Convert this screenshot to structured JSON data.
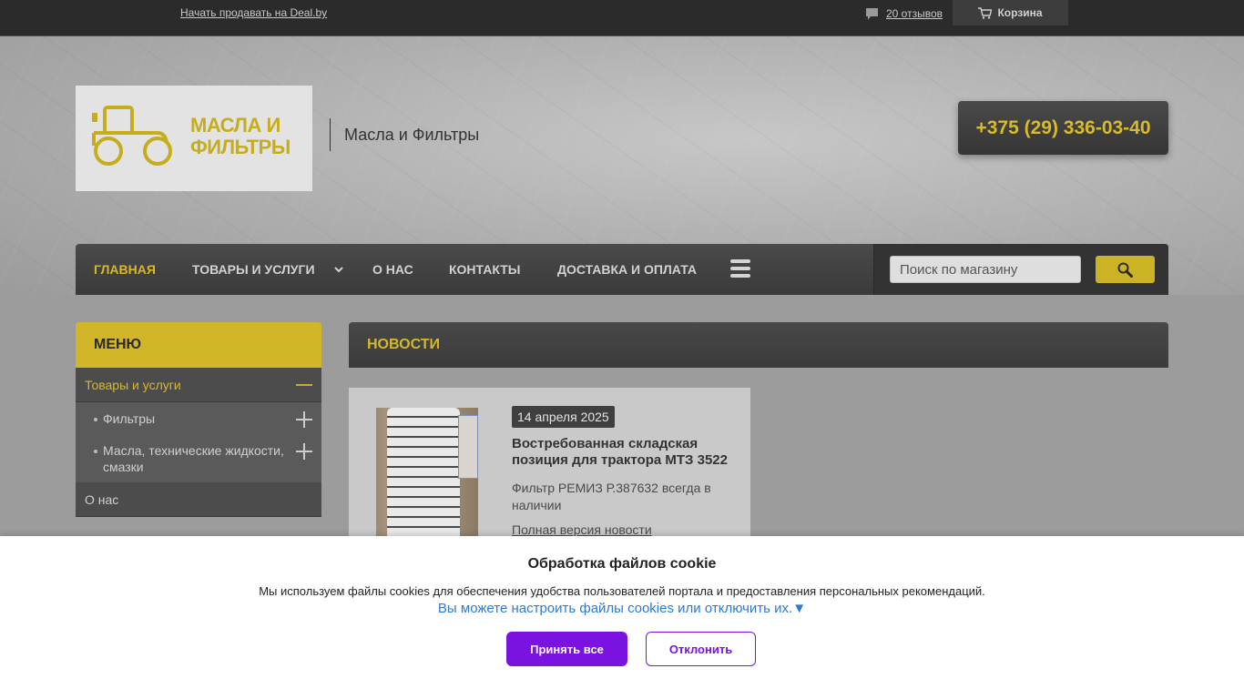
{
  "topbar": {
    "sell_link": "Начать продавать на Deal.by",
    "reviews_link": "20 отзывов",
    "cart_label": "Корзина"
  },
  "header": {
    "logo_text_line1": "МАСЛА И",
    "logo_text_line2": "ФИЛЬТРЫ",
    "site_title": "Масла и Фильтры",
    "phone": "+375 (29) 336-03-40"
  },
  "nav": {
    "items": [
      {
        "label": "ГЛАВНАЯ",
        "active": true
      },
      {
        "label": "ТОВАРЫ И УСЛУГИ",
        "has_dropdown": true
      },
      {
        "label": "О НАС"
      },
      {
        "label": "КОНТАКТЫ"
      },
      {
        "label": "ДОСТАВКА И ОПЛАТА"
      }
    ],
    "search_placeholder": "Поиск по магазину"
  },
  "sidebar": {
    "title": "МЕНЮ",
    "items": [
      {
        "label": "Товары и услуги",
        "active": true,
        "expanded": true
      },
      {
        "label": "Фильтры"
      },
      {
        "label": "Масла, технические жидкости, смазки"
      },
      {
        "label": "О нас"
      }
    ]
  },
  "news": {
    "section_title": "НОВОСТИ",
    "items": [
      {
        "date": "14 апреля 2025",
        "title": "Востребованная складская позиция для трактора МТЗ 3522",
        "text": "Фильтр РЕМИЗ Р.387632 всегда в наличии",
        "more": "Полная версия новости"
      }
    ]
  },
  "cookie": {
    "title": "Обработка файлов cookie",
    "text": "Мы используем файлы cookies для обеспечения удобства пользователей портала и предоставления персональных рекомендаций.",
    "link": "Вы можете настроить файлы cookies или отключить их.▼",
    "accept": "Принять все",
    "decline": "Отклонить"
  },
  "colors": {
    "accent_yellow": "#d6b82c",
    "dark_panel": "#3f3f3f",
    "cookie_purple": "#7a12e0",
    "cookie_link": "#2a7ad4"
  },
  "icons": [
    "chat-icon",
    "cart-icon",
    "tractor-logo-icon",
    "chevron-down-icon",
    "hamburger-menu-icon",
    "search-icon",
    "minus-icon",
    "plus-icon"
  ]
}
